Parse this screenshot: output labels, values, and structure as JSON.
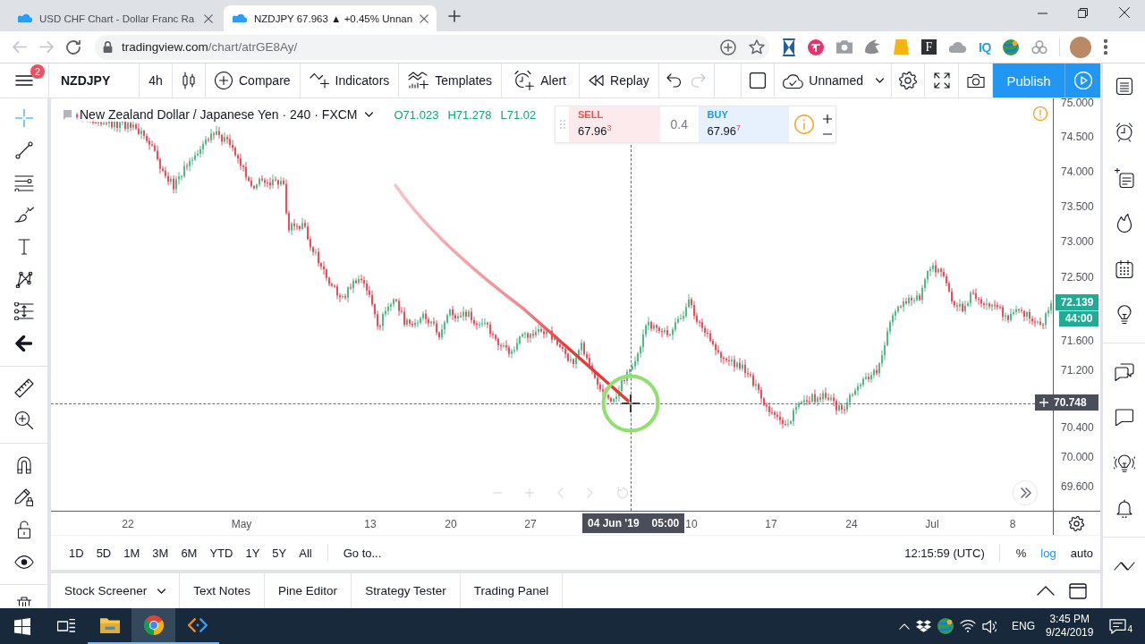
{
  "browser": {
    "tabs": [
      {
        "title": "USD CHF Chart - Dollar Franc Ra",
        "selected": false
      },
      {
        "title": "NZDJPY 67.963 ▲ +0.45% Unnan",
        "selected": true
      }
    ],
    "nav": {
      "back_disabled": true,
      "forward_disabled": true
    },
    "url": {
      "host": "tradingview.com",
      "path": "/chart/atrGE8Ay/"
    },
    "extension_labels": [
      "F",
      "IQ"
    ]
  },
  "toolbar": {
    "menu_badge": "2",
    "symbol": "NZDJPY",
    "interval": "4h",
    "actions": [
      "Compare",
      "Indicators",
      "Templates",
      "Alert",
      "Replay"
    ],
    "undo_disabled": false,
    "redo_disabled": true,
    "layout_name": "Unnamed",
    "publish": "Publish"
  },
  "tool_groups": [
    [
      {
        "selected": true
      },
      {
        "selected": false
      },
      {
        "selected": false
      },
      {
        "selected": false
      },
      {
        "selected": false
      },
      {
        "selected": false
      },
      {
        "selected": false
      },
      {
        "selected": false
      }
    ],
    [
      {
        "selected": false
      },
      {
        "selected": false
      }
    ],
    [
      {
        "selected": false
      },
      {
        "selected": false
      },
      {
        "selected": false
      },
      {
        "selected": false
      }
    ],
    [
      {
        "selected": false
      }
    ]
  ],
  "chart": {
    "legend": {
      "title": "New Zealand Dollar / Japanese Yen · 240 · FXCM",
      "values": [
        "O71.023",
        "H71.278",
        "L71.02"
      ]
    },
    "trade": {
      "sell_label": "SELL",
      "sell_price": "67.96$^{3}$",
      "spread": "0.4",
      "buy_label": "BUY",
      "buy_price": "67.96$^{7}$"
    },
    "price_axis": [
      "75.000",
      "74.500",
      "74.000",
      "73.500",
      "73.000",
      "72.500",
      "71.600",
      "71.200",
      "70.400",
      "70.000",
      "69.600"
    ],
    "last_price": "72.139",
    "countdown": "44:00",
    "crosshair": {
      "price": "70.748",
      "date": "04 Jun '19",
      "time": "05:00"
    },
    "time_axis": [
      "22",
      "May",
      "13",
      "20",
      "27",
      "10",
      "17",
      "24",
      "Jul",
      "8"
    ]
  },
  "bottom_bar": {
    "ranges": [
      "1D",
      "5D",
      "1M",
      "3M",
      "6M",
      "YTD",
      "1Y",
      "5Y",
      "All"
    ],
    "goto": "Go to...",
    "clock": "12:15:59 (UTC)",
    "scale": [
      {
        "label": "%",
        "selected": false
      },
      {
        "label": "log",
        "selected": true
      },
      {
        "label": "auto",
        "selected": false
      }
    ]
  },
  "panel_tabs": [
    {
      "label": "Stock Screener",
      "dropdown": true
    },
    {
      "label": "Text Notes",
      "dropdown": false
    },
    {
      "label": "Pine Editor",
      "dropdown": false
    },
    {
      "label": "Strategy Tester",
      "dropdown": false
    },
    {
      "label": "Trading Panel",
      "dropdown": false
    }
  ],
  "taskbar": {
    "apps": [
      {
        "running": true,
        "selected": false
      },
      {
        "running": true,
        "selected": true
      },
      {
        "running": true,
        "selected": false
      }
    ],
    "language": "ENG",
    "time": "3:45 PM",
    "date": "9/24/2019",
    "notifications": "4"
  }
}
